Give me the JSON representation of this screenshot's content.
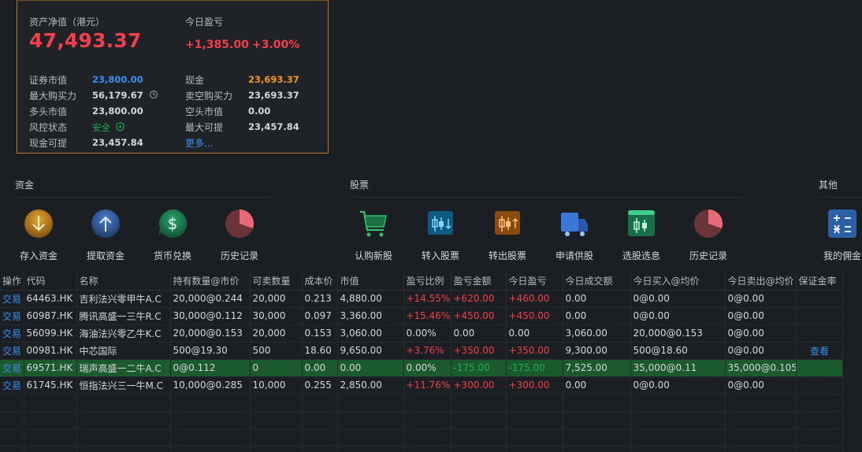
{
  "account": {
    "net_asset_label": "资产净值（港元）",
    "net_asset_value": "47,493.37",
    "today_pnl_label": "今日盈亏",
    "today_pnl_amount": "+1,385.00",
    "today_pnl_pct": "+3.00%",
    "left_kv": [
      {
        "label": "证券市值",
        "value": "23,800.00"
      },
      {
        "label": "最大购买力",
        "value": "56,179.67"
      },
      {
        "label": "多头市值",
        "value": "23,800.00"
      },
      {
        "label": "风控状态",
        "value": "安全"
      },
      {
        "label": "现金可提",
        "value": "23,457.84"
      }
    ],
    "right_kv": [
      {
        "label": "现金",
        "value": "23,693.37"
      },
      {
        "label": "卖空购买力",
        "value": "23,693.37"
      },
      {
        "label": "空头市值",
        "value": "0.00"
      },
      {
        "label": "最大可提",
        "value": "23,457.84"
      }
    ],
    "more_link": "更多..."
  },
  "sections": {
    "funds": {
      "title": "资金",
      "actions": [
        "存入资金",
        "提取资金",
        "货币兑换",
        "历史记录"
      ]
    },
    "stocks": {
      "title": "股票",
      "actions": [
        "认购新股",
        "转入股票",
        "转出股票",
        "申请供股",
        "选股选息",
        "历史记录"
      ]
    },
    "other": {
      "title": "其他",
      "actions": [
        "我的佣金"
      ]
    }
  },
  "table": {
    "headers": [
      "操作",
      "代码",
      "名称",
      "持有数量@市价",
      "可卖数量",
      "成本价",
      "市值",
      "盈亏比例",
      "盈亏金额",
      "今日盈亏",
      "今日成交额",
      "今日买入@均价",
      "今日卖出@均价",
      "保证金率"
    ],
    "rows": [
      {
        "action": "交易",
        "code": "64463.HK",
        "name": "吉利法兴零甲牛A.C",
        "hold": "20,000@0.244",
        "sellable": "20,000",
        "cost": "0.213",
        "mkt": "4,880.00",
        "pct": "+14.55%",
        "pnl": "+620.00",
        "today": "+460.00",
        "turnover": "0.00",
        "buy": "0@0.00",
        "sell": "0@0.00",
        "margin": ""
      },
      {
        "action": "交易",
        "code": "60987.HK",
        "name": "腾讯高盛一三牛R.C",
        "hold": "30,000@0.112",
        "sellable": "30,000",
        "cost": "0.097",
        "mkt": "3,360.00",
        "pct": "+15.46%",
        "pnl": "+450.00",
        "today": "+450.00",
        "turnover": "0.00",
        "buy": "0@0.00",
        "sell": "0@0.00",
        "margin": ""
      },
      {
        "action": "交易",
        "code": "56099.HK",
        "name": "海油法兴零乙牛K.C",
        "hold": "20,000@0.153",
        "sellable": "20,000",
        "cost": "0.153",
        "mkt": "3,060.00",
        "pct": "0.00%",
        "pnl": "0.00",
        "today": "0.00",
        "turnover": "3,060.00",
        "buy": "20,000@0.153",
        "sell": "0@0.00",
        "margin": ""
      },
      {
        "action": "交易",
        "code": "00981.HK",
        "name": "中芯国际",
        "hold": "500@19.30",
        "sellable": "500",
        "cost": "18.60",
        "mkt": "9,650.00",
        "pct": "+3.76%",
        "pnl": "+350.00",
        "today": "+350.00",
        "turnover": "9,300.00",
        "buy": "500@18.60",
        "sell": "0@0.00",
        "margin": "查看"
      },
      {
        "action": "交易",
        "code": "69571.HK",
        "name": "瑞声高盛一二牛A.C",
        "hold": "0@0.112",
        "sellable": "0",
        "cost": "0.00",
        "mkt": "0.00",
        "pct": "0.00%",
        "pnl": "-175.00",
        "today": "-175.00",
        "turnover": "7,525.00",
        "buy": "35,000@0.11",
        "sell": "35,000@0.105",
        "margin": ""
      },
      {
        "action": "交易",
        "code": "61745.HK",
        "name": "恒指法兴三一牛M.C",
        "hold": "10,000@0.285",
        "sellable": "10,000",
        "cost": "0.255",
        "mkt": "2,850.00",
        "pct": "+11.76%",
        "pnl": "+300.00",
        "today": "+300.00",
        "turnover": "0.00",
        "buy": "0@0.00",
        "sell": "0@0.00",
        "margin": ""
      }
    ],
    "selected_row": 4
  },
  "colors": {
    "up": "#f2404a",
    "down": "#22b054",
    "link": "#3b8ff0",
    "accent_orange": "#f59a1e",
    "selected_row_bg": "#1b5a2c"
  }
}
